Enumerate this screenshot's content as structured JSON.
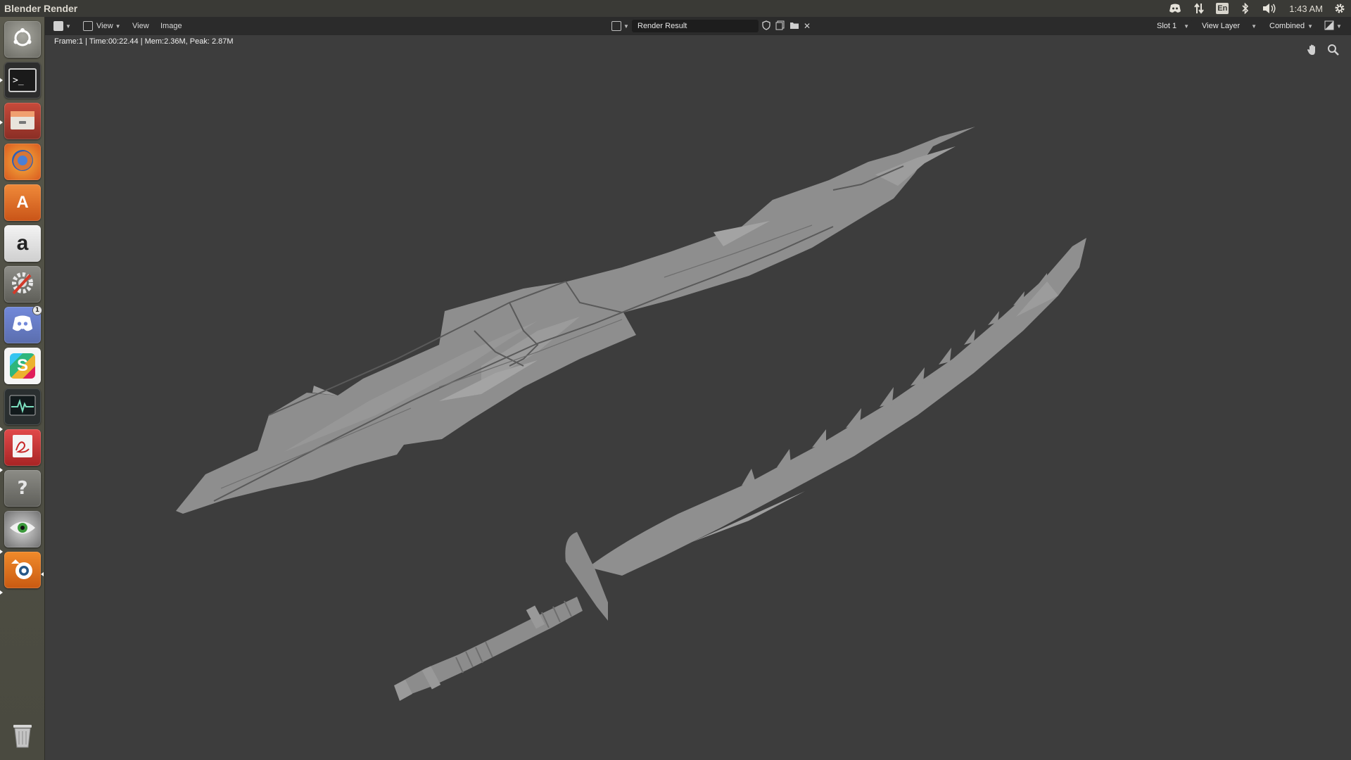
{
  "system_bar": {
    "app_title": "Blender Render",
    "clock": "1:43 AM",
    "keyboard_layout": "En",
    "tray_icons": [
      "discord-icon",
      "network-icon",
      "keyboard-layout-icon",
      "bluetooth-icon",
      "volume-icon",
      "settings-gear-icon"
    ]
  },
  "launcher": {
    "items": [
      {
        "name": "ubuntu-dash",
        "icon": "dash-icon"
      },
      {
        "name": "terminal",
        "icon": "terminal-icon",
        "label": ">_"
      },
      {
        "name": "files",
        "icon": "files-icon"
      },
      {
        "name": "firefox",
        "icon": "firefox-icon"
      },
      {
        "name": "software-center",
        "icon": "software-center-icon",
        "label": "A"
      },
      {
        "name": "amazon",
        "icon": "amazon-icon",
        "label": "a"
      },
      {
        "name": "system-settings",
        "icon": "system-settings-icon"
      },
      {
        "name": "discord",
        "icon": "discord-icon",
        "badge": "1"
      },
      {
        "name": "slack",
        "icon": "slack-icon",
        "label": "S"
      },
      {
        "name": "system-monitor",
        "icon": "system-monitor-icon"
      },
      {
        "name": "document-viewer",
        "icon": "document-viewer-icon"
      },
      {
        "name": "help",
        "icon": "help-icon",
        "label": "?"
      },
      {
        "name": "eye-app",
        "icon": "eye-icon"
      },
      {
        "name": "blender",
        "icon": "blender-icon"
      },
      {
        "name": "trash",
        "icon": "trash-icon"
      }
    ]
  },
  "header": {
    "menu_view_dropdown": "View",
    "menu_view": "View",
    "menu_image": "Image",
    "image_name": "Render Result",
    "slot": "Slot 1",
    "view_layer": "View Layer",
    "pass": "Combined"
  },
  "status": {
    "text": "Frame:1 | Time:00:22.44 | Mem:2.36M, Peak: 2.87M"
  },
  "colors": {
    "viewport_bg": "#3d3d3d",
    "header_bg": "#2b2b2b",
    "model_fill": "#8f8f8f",
    "system_bar_bg": "#3a3a36"
  }
}
